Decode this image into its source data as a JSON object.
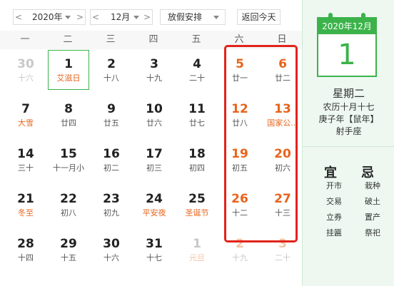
{
  "toolbar": {
    "prev_year": "<",
    "year": "2020年",
    "next_year": ">",
    "prev_month": "<",
    "month": "12月",
    "next_month": ">",
    "holiday": "放假安排",
    "today_button": "返回今天"
  },
  "weekdays": [
    "一",
    "二",
    "三",
    "四",
    "五",
    "六",
    "日"
  ],
  "weeks": [
    [
      {
        "day": "30",
        "sub": "十六",
        "other": true
      },
      {
        "day": "1",
        "sub": "艾滋日",
        "today": true
      },
      {
        "day": "2",
        "sub": "十八"
      },
      {
        "day": "3",
        "sub": "十九"
      },
      {
        "day": "4",
        "sub": "二十"
      },
      {
        "day": "5",
        "sub": "廿一",
        "weekend": true
      },
      {
        "day": "6",
        "sub": "廿二",
        "weekend": true
      }
    ],
    [
      {
        "day": "7",
        "sub": "大雪",
        "fest": true
      },
      {
        "day": "8",
        "sub": "廿四"
      },
      {
        "day": "9",
        "sub": "廿五"
      },
      {
        "day": "10",
        "sub": "廿六"
      },
      {
        "day": "11",
        "sub": "廿七"
      },
      {
        "day": "12",
        "sub": "廿八",
        "weekend": true
      },
      {
        "day": "13",
        "sub": "国家公...",
        "weekend": true,
        "fest": true
      }
    ],
    [
      {
        "day": "14",
        "sub": "三十"
      },
      {
        "day": "15",
        "sub": "十一月小"
      },
      {
        "day": "16",
        "sub": "初二"
      },
      {
        "day": "17",
        "sub": "初三"
      },
      {
        "day": "18",
        "sub": "初四"
      },
      {
        "day": "19",
        "sub": "初五",
        "weekend": true
      },
      {
        "day": "20",
        "sub": "初六",
        "weekend": true
      }
    ],
    [
      {
        "day": "21",
        "sub": "冬至",
        "fest": true
      },
      {
        "day": "22",
        "sub": "初八"
      },
      {
        "day": "23",
        "sub": "初九"
      },
      {
        "day": "24",
        "sub": "平安夜",
        "fest": true
      },
      {
        "day": "25",
        "sub": "圣诞节",
        "fest": true
      },
      {
        "day": "26",
        "sub": "十二",
        "weekend": true
      },
      {
        "day": "27",
        "sub": "十三",
        "weekend": true
      }
    ],
    [
      {
        "day": "28",
        "sub": "十四"
      },
      {
        "day": "29",
        "sub": "十五"
      },
      {
        "day": "30",
        "sub": "十六"
      },
      {
        "day": "31",
        "sub": "十七"
      },
      {
        "day": "1",
        "sub": "元旦",
        "other": true,
        "fest": true
      },
      {
        "day": "2",
        "sub": "十九",
        "other": true,
        "weekend": true
      },
      {
        "day": "3",
        "sub": "二十",
        "other": true,
        "weekend": true
      }
    ]
  ],
  "panel": {
    "header": "2020年12月",
    "big_day": "1",
    "weekday": "星期二",
    "lunar": "农历十月十七",
    "ganzhi": "庚子年【鼠年】",
    "zodiac": "射手座",
    "yi_label": "宜",
    "ji_label": "忌",
    "yi": [
      "开市",
      "交易",
      "立券",
      "挂匾"
    ],
    "ji": [
      "栽种",
      "破土",
      "置产",
      "祭祀"
    ]
  },
  "colors": {
    "accent_green": "#3bb34a",
    "weekend_orange": "#e8641b",
    "frame_red": "#e2231a",
    "panel_bg": "#eef8f1"
  }
}
